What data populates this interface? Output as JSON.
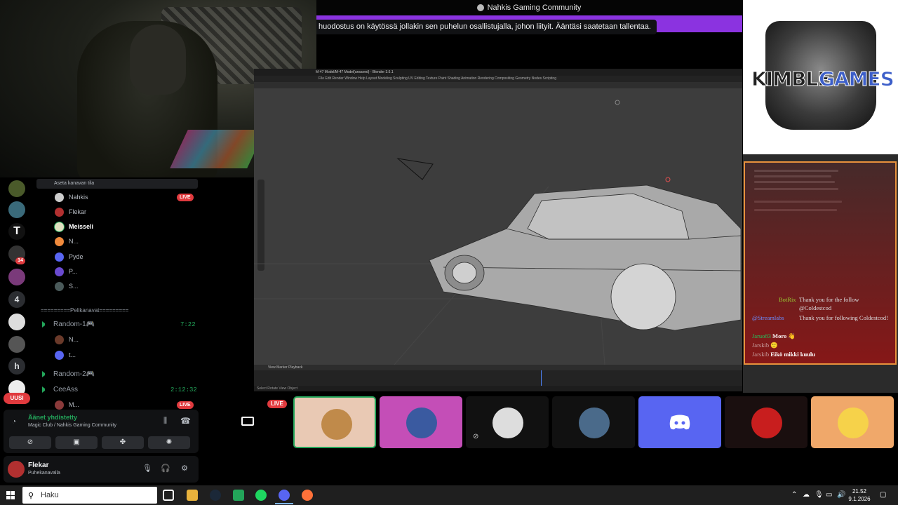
{
  "topbar": {
    "server_title": "Nahkis Gaming Community"
  },
  "notice": {
    "text": "huodostus on käytössä jollakin sen puhelun osallistujalla, johon liityit. Ääntäsi saatetaan tallentaa."
  },
  "servers": {
    "badge_count": "14",
    "number_item": "4",
    "letter_item": "h",
    "new_label": "UUSI"
  },
  "channels": {
    "set_status": "Aseta kanavan tila",
    "voice_users": [
      "Nahkis",
      "Flekar",
      "Meisseli",
      "N...",
      "Pyde",
      "P...",
      "S..."
    ],
    "live_label": "LIVE",
    "category": "=========Pelikanavat=========",
    "list": [
      {
        "name": "Random-1🎮",
        "time": "7:22"
      },
      {
        "name": "Random-2🎮",
        "time": ""
      },
      {
        "name": "CeeAss",
        "time": "2:12:32"
      }
    ],
    "random1_users": [
      "N...",
      "t..."
    ],
    "ceeass_users": [
      "M..."
    ]
  },
  "voice_panel": {
    "title": "Äänet yhdistetty",
    "subtitle": "Magic Club / Nahkis Gaming Community"
  },
  "user_panel": {
    "name": "Flekar",
    "status": "Puhekanavalla"
  },
  "blender": {
    "title": "M-47 Model/M-47 Model(unsaved) - Blender 3.6.1",
    "menu": "File  Edit  Render  Window  Help   Layout  Modeling  Sculpting  UV Editing  Texture Paint  Shading  Animation  Rendering  Compositing  Geometry Nodes  Scripting",
    "timeline_menu": "View   Marker   Playback",
    "status": "Select     Rotate View     Object"
  },
  "logo": {
    "part1": "KIMBLE",
    "part2": "GAMES"
  },
  "chat": [
    {
      "user": "BotRix",
      "user_color": "#9acd32",
      "message": "Thank you for the follow @Coldestcod"
    },
    {
      "user": "@Streamlabs",
      "user_color": "#6a8cff",
      "message": "Thank you for following Coldestcod!"
    },
    {
      "user": "Jaruo83",
      "user_color": "#22c55e",
      "message": "Moro 👋"
    },
    {
      "user": "Jarskib",
      "user_color": "#c9a0a0",
      "message": "🙂"
    },
    {
      "user": "Jarskib",
      "user_color": "#c9a0a0",
      "message": "Eikö mikki kuulu"
    }
  ],
  "tiles": {
    "live_label": "LIVE"
  },
  "taskbar": {
    "search_placeholder": "Haku",
    "time": "21.52",
    "date": "9.1.2026"
  },
  "colors": {
    "discord_blurple": "#5865f2",
    "live_red": "#e03a3e",
    "voice_green": "#23a55a",
    "purple_banner": "#8b33e0"
  }
}
